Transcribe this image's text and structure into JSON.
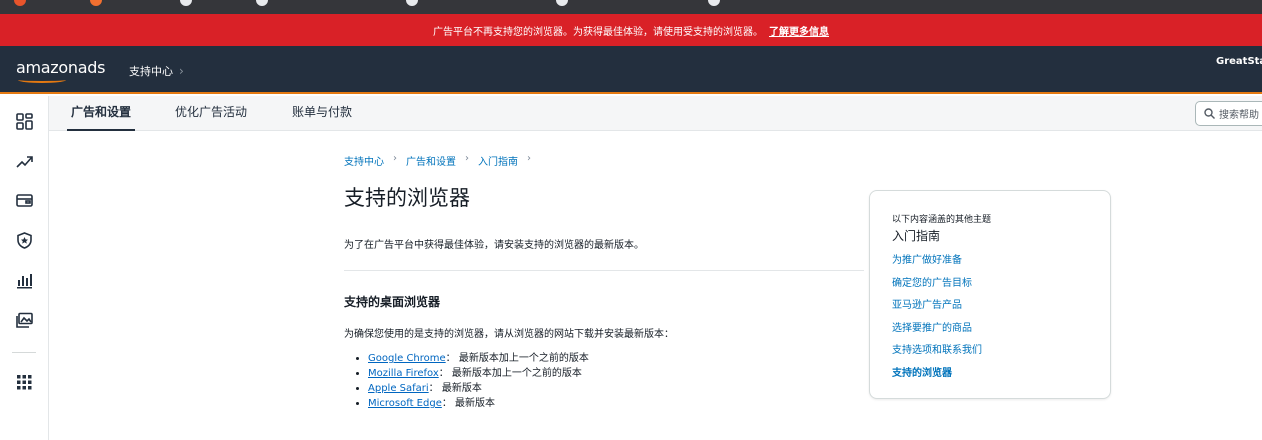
{
  "alert": {
    "message": "广告平台不再支持您的浏览器。为获得最佳体验，请使用受支持的浏览器。",
    "link": "了解更多信息"
  },
  "header": {
    "logo": "amazonads",
    "breadcrumb": "支持中心",
    "account": "GreatStar"
  },
  "tabs": [
    {
      "label": "广告和设置"
    },
    {
      "label": "优化广告活动"
    },
    {
      "label": "账单与付款"
    }
  ],
  "search": {
    "placeholder": "搜索帮助"
  },
  "breadcrumbs": [
    "支持中心",
    "广告和设置",
    "入门指南"
  ],
  "page": {
    "title": "支持的浏览器",
    "intro": "为了在广告平台中获得最佳体验，请安装支持的浏览器的最新版本。",
    "section_title": "支持的桌面浏览器",
    "section_desc": "为确保您使用的是支持的浏览器，请从浏览器的网站下载并安装最新版本：",
    "browsers": [
      {
        "name": "Google Chrome",
        "version": "：   最新版本加上一个之前的版本"
      },
      {
        "name": "Mozilla Firefox",
        "version": "：   最新版本加上一个之前的版本"
      },
      {
        "name": "Apple Safari",
        "version": "：   最新版本"
      },
      {
        "name": "Microsoft Edge",
        "version": "：   最新版本"
      }
    ]
  },
  "related": {
    "caption": "以下内容涵盖的其他主题",
    "title": "入门指南",
    "links": [
      "为推广做好准备",
      "确定您的广告目标",
      "亚马逊广告产品",
      "选择要推广的商品",
      "支持选项和联系我们",
      "支持的浏览器"
    ]
  },
  "colors": {
    "alert_bg": "#d92127",
    "nav_bg": "#232f3e",
    "accent": "#e47911",
    "link": "#0073bb"
  },
  "sidebar_icons": [
    "dashboard-icon",
    "trend-icon",
    "wallet-icon",
    "shield-icon",
    "bar-chart-icon",
    "media-icon",
    "apps-grid-icon"
  ]
}
